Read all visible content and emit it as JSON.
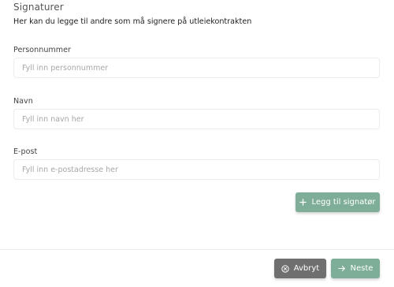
{
  "section": {
    "title": "Signaturer",
    "description": "Her kan du legge til andre som må signere på utleiekontrakten"
  },
  "fields": [
    {
      "label": "Personnummer",
      "placeholder": "Fyll inn personnummer",
      "value": ""
    },
    {
      "label": "Navn",
      "placeholder": "Fyll inn navn her",
      "value": ""
    },
    {
      "label": "E-post",
      "placeholder": "Fyll inn e-postadresse her",
      "value": ""
    }
  ],
  "actions": {
    "add_signer_label": "Legg til signatør",
    "cancel_label": "Avbryt",
    "next_label": "Neste"
  },
  "icons": {
    "add": "plus-icon",
    "cancel": "circle-x-icon",
    "next": "arrow-right-icon"
  },
  "colors": {
    "primary": "#7fae98",
    "secondary": "#6f6f6f"
  }
}
